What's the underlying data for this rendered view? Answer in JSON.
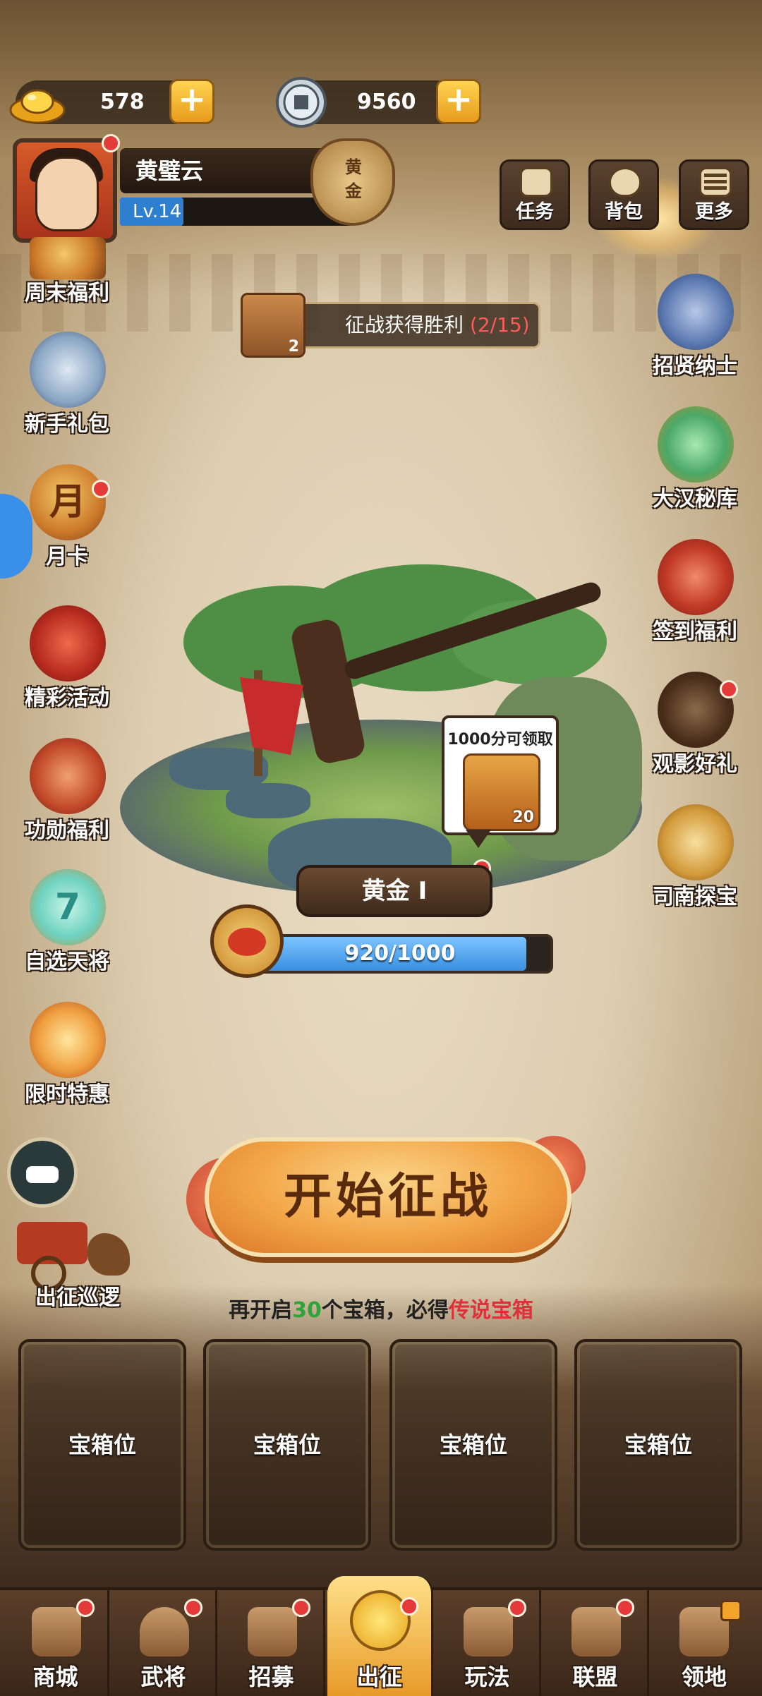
{
  "currency": {
    "gold": {
      "value": "578",
      "icon": "gold-ingot-icon"
    },
    "coin": {
      "value": "9560",
      "icon": "copper-coin-icon"
    },
    "plus_symbol": "+"
  },
  "profile": {
    "name": "黄璧云",
    "level": "Lv.14",
    "rank_badge": "黄金"
  },
  "top_buttons": [
    {
      "label": "任务",
      "icon": "scroll-icon"
    },
    {
      "label": "背包",
      "icon": "bag-icon"
    },
    {
      "label": "更多",
      "icon": "menu-icon"
    }
  ],
  "left_sidebar": [
    {
      "label": "周末福利"
    },
    {
      "label": "新手礼包"
    },
    {
      "label": "月卡",
      "glyph": "月"
    },
    {
      "label": "精彩活动"
    },
    {
      "label": "功勋福利"
    },
    {
      "label": "自选天将",
      "glyph": "7"
    },
    {
      "label": "限时特惠"
    }
  ],
  "right_sidebar": [
    {
      "label": "招贤纳士"
    },
    {
      "label": "大汉秘库"
    },
    {
      "label": "签到福利"
    },
    {
      "label": "观影好礼"
    },
    {
      "label": "司南探宝"
    }
  ],
  "quest": {
    "count": "2",
    "text": "征战获得胜利",
    "progress": "(2/15)"
  },
  "reward_bubble": {
    "title": "1000分可领取",
    "count": "20"
  },
  "rank_plate": "黄金 I",
  "score": {
    "text": "920/1000",
    "current": 920,
    "max": 1000
  },
  "start_button": "开始征战",
  "hint": {
    "prefix": "再开启",
    "number": "30",
    "middle": "个宝箱，必得",
    "highlight": "传说宝箱"
  },
  "patrol_label": "出征巡逻",
  "chest_slots": [
    "宝箱位",
    "宝箱位",
    "宝箱位",
    "宝箱位"
  ],
  "nav": [
    {
      "label": "商城"
    },
    {
      "label": "武将"
    },
    {
      "label": "招募"
    },
    {
      "label": "出征",
      "active": true
    },
    {
      "label": "玩法"
    },
    {
      "label": "联盟"
    },
    {
      "label": "领地"
    }
  ]
}
